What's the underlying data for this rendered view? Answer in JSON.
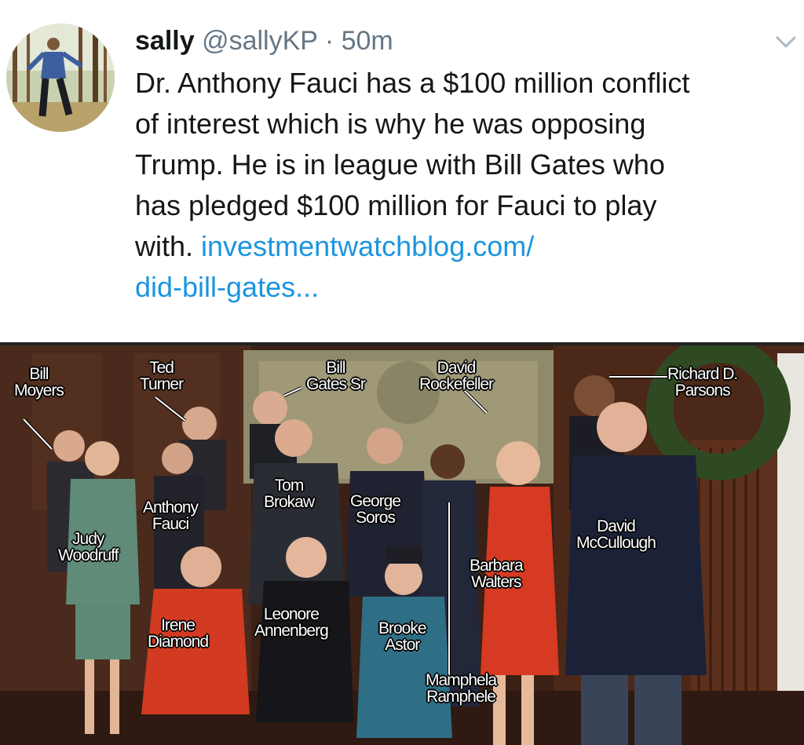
{
  "tweet": {
    "name": "sally",
    "handle": "@sallyKP",
    "separator": "·",
    "time": "50m",
    "menu_icon": "chevron-down-icon",
    "text_lines": [
      "Dr. Anthony Fauci has a $100 million conflict",
      "of interest which is why he was opposing",
      "Trump. He is in league with Bill Gates who",
      "has pledged $100 million for Fauci to play"
    ],
    "text_last_prefix": "with. ",
    "link_line1": "investmentwatchblog.com/",
    "link_line2": "did-bill-gates..."
  },
  "photo_labels": {
    "bill_moyers": [
      "Bill",
      "Moyers"
    ],
    "ted_turner": [
      "Ted",
      "Turner"
    ],
    "bill_gates_sr": [
      "Bill",
      "Gates Sr"
    ],
    "david_rockefeller": [
      "David",
      "Rockefeller"
    ],
    "richard_parsons": [
      "Richard D.",
      "Parsons"
    ],
    "tom_brokaw": [
      "Tom",
      "Brokaw"
    ],
    "george_soros": [
      "George",
      "Soros"
    ],
    "anthony_fauci": [
      "Anthony",
      "Fauci"
    ],
    "judy_woodruff": [
      "Judy",
      "Woodruff"
    ],
    "david_mccullough": [
      "David",
      "McCullough"
    ],
    "barbara_walters": [
      "Barbara",
      "Walters"
    ],
    "leonore_annenberg": [
      "Leonore",
      "Annenberg"
    ],
    "irene_diamond": [
      "Irene",
      "Diamond"
    ],
    "brooke_astor": [
      "Brooke",
      "Astor"
    ],
    "mamphela_ramphele": [
      "Mamphela",
      "Ramphele"
    ]
  },
  "colors": {
    "link": "#1b95e0",
    "secondary_text": "#657786"
  }
}
